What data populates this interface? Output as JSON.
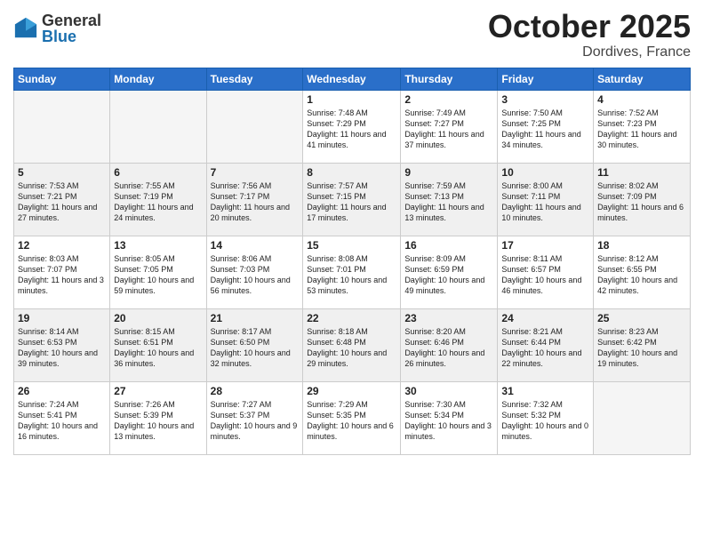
{
  "header": {
    "logo_general": "General",
    "logo_blue": "Blue",
    "month": "October 2025",
    "location": "Dordives, France"
  },
  "days_of_week": [
    "Sunday",
    "Monday",
    "Tuesday",
    "Wednesday",
    "Thursday",
    "Friday",
    "Saturday"
  ],
  "weeks": [
    {
      "shaded": false,
      "days": [
        {
          "num": "",
          "detail": ""
        },
        {
          "num": "",
          "detail": ""
        },
        {
          "num": "",
          "detail": ""
        },
        {
          "num": "1",
          "detail": "Sunrise: 7:48 AM\nSunset: 7:29 PM\nDaylight: 11 hours\nand 41 minutes."
        },
        {
          "num": "2",
          "detail": "Sunrise: 7:49 AM\nSunset: 7:27 PM\nDaylight: 11 hours\nand 37 minutes."
        },
        {
          "num": "3",
          "detail": "Sunrise: 7:50 AM\nSunset: 7:25 PM\nDaylight: 11 hours\nand 34 minutes."
        },
        {
          "num": "4",
          "detail": "Sunrise: 7:52 AM\nSunset: 7:23 PM\nDaylight: 11 hours\nand 30 minutes."
        }
      ]
    },
    {
      "shaded": true,
      "days": [
        {
          "num": "5",
          "detail": "Sunrise: 7:53 AM\nSunset: 7:21 PM\nDaylight: 11 hours\nand 27 minutes."
        },
        {
          "num": "6",
          "detail": "Sunrise: 7:55 AM\nSunset: 7:19 PM\nDaylight: 11 hours\nand 24 minutes."
        },
        {
          "num": "7",
          "detail": "Sunrise: 7:56 AM\nSunset: 7:17 PM\nDaylight: 11 hours\nand 20 minutes."
        },
        {
          "num": "8",
          "detail": "Sunrise: 7:57 AM\nSunset: 7:15 PM\nDaylight: 11 hours\nand 17 minutes."
        },
        {
          "num": "9",
          "detail": "Sunrise: 7:59 AM\nSunset: 7:13 PM\nDaylight: 11 hours\nand 13 minutes."
        },
        {
          "num": "10",
          "detail": "Sunrise: 8:00 AM\nSunset: 7:11 PM\nDaylight: 11 hours\nand 10 minutes."
        },
        {
          "num": "11",
          "detail": "Sunrise: 8:02 AM\nSunset: 7:09 PM\nDaylight: 11 hours\nand 6 minutes."
        }
      ]
    },
    {
      "shaded": false,
      "days": [
        {
          "num": "12",
          "detail": "Sunrise: 8:03 AM\nSunset: 7:07 PM\nDaylight: 11 hours\nand 3 minutes."
        },
        {
          "num": "13",
          "detail": "Sunrise: 8:05 AM\nSunset: 7:05 PM\nDaylight: 10 hours\nand 59 minutes."
        },
        {
          "num": "14",
          "detail": "Sunrise: 8:06 AM\nSunset: 7:03 PM\nDaylight: 10 hours\nand 56 minutes."
        },
        {
          "num": "15",
          "detail": "Sunrise: 8:08 AM\nSunset: 7:01 PM\nDaylight: 10 hours\nand 53 minutes."
        },
        {
          "num": "16",
          "detail": "Sunrise: 8:09 AM\nSunset: 6:59 PM\nDaylight: 10 hours\nand 49 minutes."
        },
        {
          "num": "17",
          "detail": "Sunrise: 8:11 AM\nSunset: 6:57 PM\nDaylight: 10 hours\nand 46 minutes."
        },
        {
          "num": "18",
          "detail": "Sunrise: 8:12 AM\nSunset: 6:55 PM\nDaylight: 10 hours\nand 42 minutes."
        }
      ]
    },
    {
      "shaded": true,
      "days": [
        {
          "num": "19",
          "detail": "Sunrise: 8:14 AM\nSunset: 6:53 PM\nDaylight: 10 hours\nand 39 minutes."
        },
        {
          "num": "20",
          "detail": "Sunrise: 8:15 AM\nSunset: 6:51 PM\nDaylight: 10 hours\nand 36 minutes."
        },
        {
          "num": "21",
          "detail": "Sunrise: 8:17 AM\nSunset: 6:50 PM\nDaylight: 10 hours\nand 32 minutes."
        },
        {
          "num": "22",
          "detail": "Sunrise: 8:18 AM\nSunset: 6:48 PM\nDaylight: 10 hours\nand 29 minutes."
        },
        {
          "num": "23",
          "detail": "Sunrise: 8:20 AM\nSunset: 6:46 PM\nDaylight: 10 hours\nand 26 minutes."
        },
        {
          "num": "24",
          "detail": "Sunrise: 8:21 AM\nSunset: 6:44 PM\nDaylight: 10 hours\nand 22 minutes."
        },
        {
          "num": "25",
          "detail": "Sunrise: 8:23 AM\nSunset: 6:42 PM\nDaylight: 10 hours\nand 19 minutes."
        }
      ]
    },
    {
      "shaded": false,
      "days": [
        {
          "num": "26",
          "detail": "Sunrise: 7:24 AM\nSunset: 5:41 PM\nDaylight: 10 hours\nand 16 minutes."
        },
        {
          "num": "27",
          "detail": "Sunrise: 7:26 AM\nSunset: 5:39 PM\nDaylight: 10 hours\nand 13 minutes."
        },
        {
          "num": "28",
          "detail": "Sunrise: 7:27 AM\nSunset: 5:37 PM\nDaylight: 10 hours\nand 9 minutes."
        },
        {
          "num": "29",
          "detail": "Sunrise: 7:29 AM\nSunset: 5:35 PM\nDaylight: 10 hours\nand 6 minutes."
        },
        {
          "num": "30",
          "detail": "Sunrise: 7:30 AM\nSunset: 5:34 PM\nDaylight: 10 hours\nand 3 minutes."
        },
        {
          "num": "31",
          "detail": "Sunrise: 7:32 AM\nSunset: 5:32 PM\nDaylight: 10 hours\nand 0 minutes."
        },
        {
          "num": "",
          "detail": ""
        }
      ]
    }
  ]
}
